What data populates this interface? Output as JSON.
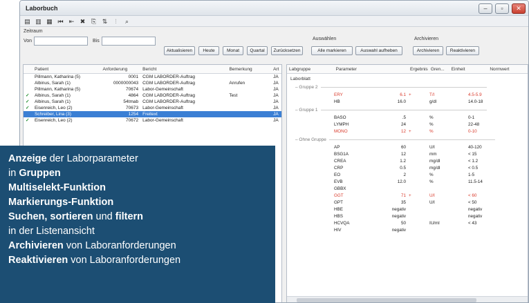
{
  "window": {
    "title": "Laborbuch",
    "buttons": {
      "minimize": "–",
      "maximize": "▫",
      "close": "✕"
    }
  },
  "toolbar": {
    "icons": [
      "list-icon",
      "report-icon",
      "print-icon",
      "first-icon",
      "prev-icon",
      "delete-icon",
      "copy-icon",
      "sort-icon",
      "filter-icon",
      "search-icon"
    ],
    "glyphs": [
      "▤",
      "▥",
      "▦",
      "⏮",
      "⇤",
      "✖",
      "⎘",
      "⇅",
      "⫶",
      "⌕"
    ]
  },
  "filters": {
    "zeitraum_label": "Zeitraum",
    "von_label": "Von",
    "bis_label": "Bis",
    "buttons": [
      "Aktualisieren",
      "Heute",
      "Monat",
      "Quartal",
      "Zurücksetzen"
    ],
    "auswaehlen_label": "Auswählen",
    "auswaehlen_buttons": [
      "Alle markieren",
      "Auswahl aufheben"
    ],
    "archivieren_label": "Archivieren",
    "archivieren_buttons": [
      "Archivieren",
      "Reaktivieren"
    ]
  },
  "left_table": {
    "headers": [
      "Patient",
      "Anforderung",
      "Bericht",
      "Bemerkung",
      "Art"
    ],
    "rows": [
      {
        "check": "",
        "patient": "Pillmann, Katharina (5)",
        "anforderung": "0001",
        "bericht": "CGM LABORDER-Auftrag",
        "bemerkung": "",
        "art": "JA"
      },
      {
        "check": "",
        "patient": "Albinus, Sarah (1)",
        "anforderung": "0000000043",
        "bericht": "CGM LABORDER-Auftrag",
        "bemerkung": "Anrufen",
        "art": "JA"
      },
      {
        "check": "",
        "patient": "Pillmann, Katharina (5)",
        "anforderung": "70674",
        "bericht": "Labor-Gemeinschaft",
        "bemerkung": "",
        "art": "JA"
      },
      {
        "check": "✓",
        "patient": "Albinus, Sarah (1)",
        "anforderung": "4864",
        "bericht": "CGM LABORDER-Auftrag",
        "bemerkung": "Test",
        "art": "JA"
      },
      {
        "check": "✓",
        "patient": "Albinus, Sarah (1)",
        "anforderung": "54tmab",
        "bericht": "CGM LABORDER-Auftrag",
        "bemerkung": "",
        "art": "JA"
      },
      {
        "check": "✓",
        "patient": "Eisenreich, Leo (2)",
        "anforderung": "70673",
        "bericht": "Labor-Gemeinschaft",
        "bemerkung": "",
        "art": "JA"
      },
      {
        "check": "",
        "patient": "Schreiber, Lina (3)",
        "anforderung": "1254",
        "bericht": "Freitext",
        "bemerkung": "",
        "art": "JA",
        "selected": true
      },
      {
        "check": "✓",
        "patient": "Eisenreich, Leo (2)",
        "anforderung": "70672",
        "bericht": "Labor-Gemeinschaft",
        "bemerkung": "",
        "art": "JA"
      }
    ]
  },
  "right_table": {
    "headers": [
      "Labgruppe",
      "Parameter",
      "Ergebnis",
      "Gren...",
      "Einheit",
      "Normwert"
    ],
    "label": "Laborblatt",
    "groups": [
      {
        "name": "Gruppe 2",
        "rows": [
          {
            "param": "ERY",
            "result": "6.1",
            "flag": "+",
            "unit": "T/l",
            "norm": "4.5-5.9",
            "abnormal": true
          },
          {
            "param": "HB",
            "result": "16.0",
            "flag": "",
            "unit": "g/dl",
            "norm": "14.0-18",
            "abnormal": false
          }
        ]
      },
      {
        "name": "Gruppe 1",
        "rows": [
          {
            "param": "BASO",
            "result": ".5",
            "flag": "",
            "unit": "%",
            "norm": "0-1",
            "abnormal": false
          },
          {
            "param": "LYMPH",
            "result": "24",
            "flag": "",
            "unit": "%",
            "norm": "22-48",
            "abnormal": false
          },
          {
            "param": "MONO",
            "result": "12",
            "flag": "+",
            "unit": "%",
            "norm": "0-10",
            "abnormal": true
          }
        ]
      },
      {
        "name": "Ohne Gruppe",
        "rows": [
          {
            "param": "AP",
            "result": "60",
            "flag": "",
            "unit": "U/l",
            "norm": "40-120",
            "abnormal": false
          },
          {
            "param": "BSG1A",
            "result": "12",
            "flag": "",
            "unit": "mm",
            "norm": "< 15",
            "abnormal": false
          },
          {
            "param": "CREA",
            "result": "1.2",
            "flag": "",
            "unit": "mg/dl",
            "norm": "< 1.2",
            "abnormal": false
          },
          {
            "param": "CRP",
            "result": "0.5",
            "flag": "",
            "unit": "mg/dl",
            "norm": "< 0.5",
            "abnormal": false
          },
          {
            "param": "EO",
            "result": "2",
            "flag": "",
            "unit": "%",
            "norm": "1-5",
            "abnormal": false
          },
          {
            "param": "EVB",
            "result": "12.0",
            "flag": "",
            "unit": "%",
            "norm": "11.5-14",
            "abnormal": false
          },
          {
            "param": "GBBX",
            "result": "",
            "flag": "",
            "unit": "",
            "norm": "",
            "abnormal": false
          },
          {
            "param": "GGT",
            "result": "71",
            "flag": "+",
            "unit": "U/l",
            "norm": "< 60",
            "abnormal": true
          },
          {
            "param": "GPT",
            "result": "35",
            "flag": "",
            "unit": "U/l",
            "norm": "< 50",
            "abnormal": false
          },
          {
            "param": "HBE",
            "result": "negativ",
            "flag": "",
            "unit": "",
            "norm": "negativ",
            "abnormal": false
          },
          {
            "param": "HBS",
            "result": "negativ",
            "flag": "",
            "unit": "",
            "norm": "negativ",
            "abnormal": false
          },
          {
            "param": "HCVQA",
            "result": "50",
            "flag": "",
            "unit": "IU/ml",
            "norm": "< 43",
            "abnormal": false
          },
          {
            "param": "HIV",
            "result": "negativ",
            "flag": "",
            "unit": "",
            "norm": "",
            "abnormal": false
          }
        ]
      }
    ]
  },
  "features": [
    [
      {
        "t": "Anzeige",
        "b": true
      },
      {
        "t": " der Laborparameter",
        "b": false
      }
    ],
    [
      {
        "t": "in ",
        "b": false
      },
      {
        "t": "Gruppen",
        "b": true
      }
    ],
    [
      {
        "t": "Multiselekt-Funktion",
        "b": true
      }
    ],
    [
      {
        "t": "Markierungs-Funktion",
        "b": true
      }
    ],
    [
      {
        "t": "Suchen, sortieren",
        "b": true
      },
      {
        "t": " und ",
        "b": false
      },
      {
        "t": "filtern",
        "b": true
      }
    ],
    [
      {
        "t": "in der Listenansicht",
        "b": false
      }
    ],
    [
      {
        "t": "Archivieren",
        "b": true
      },
      {
        "t": " von Laboranforderungen",
        "b": false
      }
    ],
    [
      {
        "t": "Reaktivieren",
        "b": true
      },
      {
        "t": " von Laboranforderungen",
        "b": false
      }
    ]
  ],
  "colors": {
    "overlay_bg": "#1c4e73",
    "selection": "#3b7fd4",
    "abnormal": "#d93a2b",
    "check": "#1c8a2c"
  }
}
